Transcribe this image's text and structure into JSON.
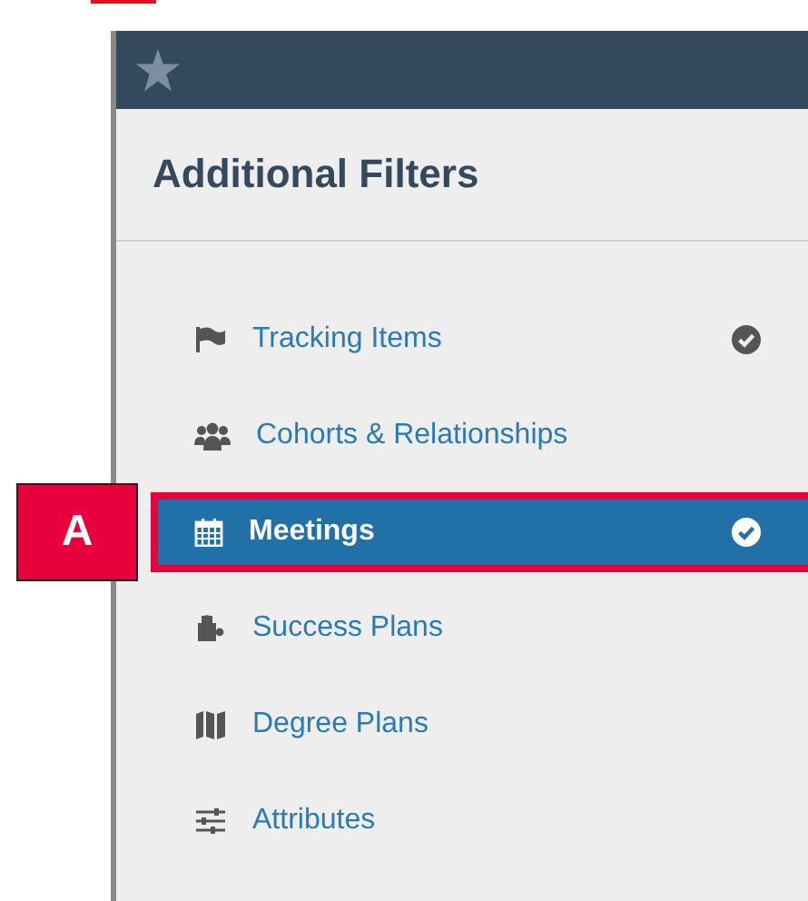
{
  "panel": {
    "title": "Additional Filters"
  },
  "filters": [
    {
      "label": "Tracking Items",
      "checked": true,
      "selected": false
    },
    {
      "label": "Cohorts & Relationships",
      "checked": false,
      "selected": false
    },
    {
      "label": "Meetings",
      "checked": true,
      "selected": true
    },
    {
      "label": "Success Plans",
      "checked": false,
      "selected": false
    },
    {
      "label": "Degree Plans",
      "checked": false,
      "selected": false
    },
    {
      "label": "Attributes",
      "checked": false,
      "selected": false
    }
  ],
  "callout": {
    "label": "A"
  }
}
